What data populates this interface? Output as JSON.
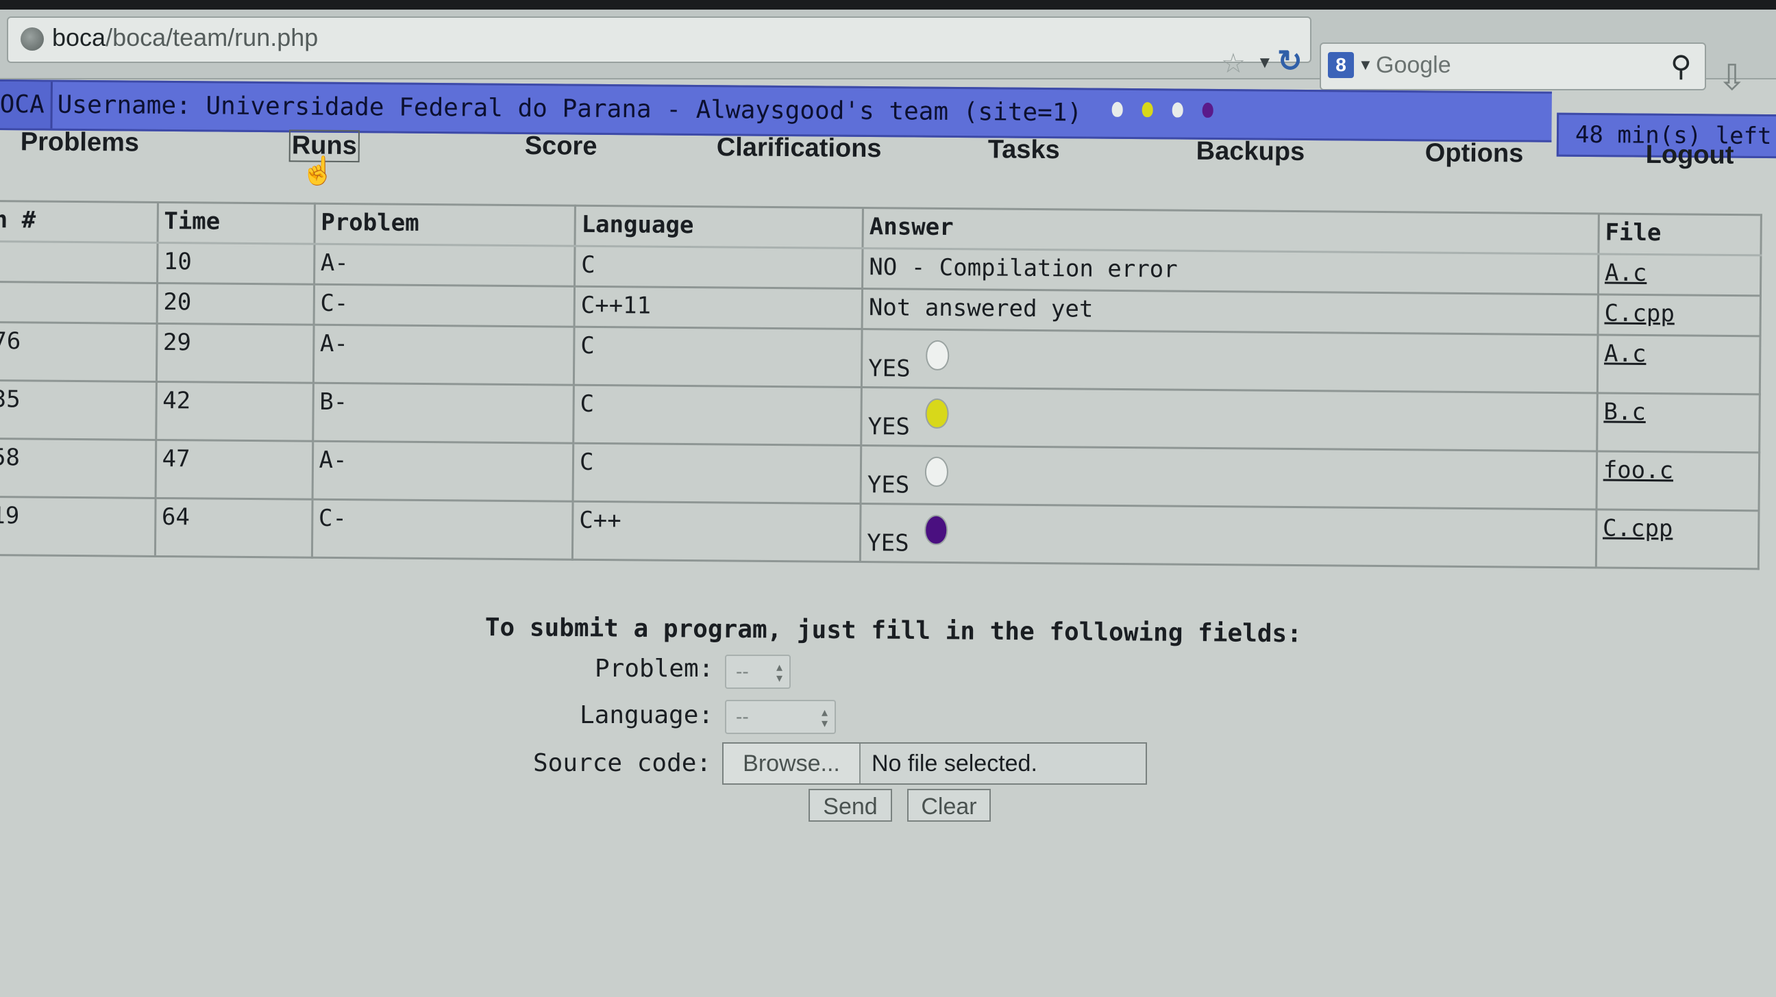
{
  "browser": {
    "url_host": "boca",
    "url_path": "/boca/team/run.php",
    "search_placeholder": "Google",
    "search_engine_glyph": "8"
  },
  "header": {
    "brand": "OCA",
    "username": "Username: Universidade Federal do Parana - Alwaysgood's team (site=1)",
    "time_left": "48 min(s) left",
    "balloon_colors": [
      "#e8ecea",
      "#d8d81a",
      "#e8ecea",
      "#5a1a8a"
    ]
  },
  "menu": {
    "items": [
      "Problems",
      "Runs",
      "Score",
      "Clarifications",
      "Tasks",
      "Backups",
      "Options",
      "Logout"
    ],
    "active": "Runs"
  },
  "runs_table": {
    "headers": [
      "n #",
      "Time",
      "Problem",
      "Language",
      "Answer",
      "File"
    ],
    "rows": [
      {
        "run": "",
        "time": "10",
        "problem": "A-",
        "language": "C",
        "answer": "NO - Compilation error",
        "file": "A.c",
        "balloon": ""
      },
      {
        "run": "",
        "time": "20",
        "problem": "C-",
        "language": "C++11",
        "answer": "Not answered yet",
        "file": "C.cpp",
        "balloon": ""
      },
      {
        "run": "76",
        "time": "29",
        "problem": "A-",
        "language": "C",
        "answer": "YES",
        "file": "A.c",
        "balloon": "#eef1ef"
      },
      {
        "run": "35",
        "time": "42",
        "problem": "B-",
        "language": "C",
        "answer": "YES",
        "file": "B.c",
        "balloon": "#d8d81a"
      },
      {
        "run": "58",
        "time": "47",
        "problem": "A-",
        "language": "C",
        "answer": "YES",
        "file": "foo.c",
        "balloon": "#eef1ef"
      },
      {
        "run": "19",
        "time": "64",
        "problem": "C-",
        "language": "C++",
        "answer": "YES",
        "file": "C.cpp",
        "balloon": "#4a1080"
      }
    ]
  },
  "submit": {
    "title": "To submit a program, just fill in the following fields:",
    "problem_label": "Problem:",
    "problem_value": "--",
    "language_label": "Language:",
    "language_value": "--",
    "source_label": "Source code:",
    "browse_label": "Browse...",
    "file_status": "No file selected.",
    "send_label": "Send",
    "clear_label": "Clear"
  }
}
